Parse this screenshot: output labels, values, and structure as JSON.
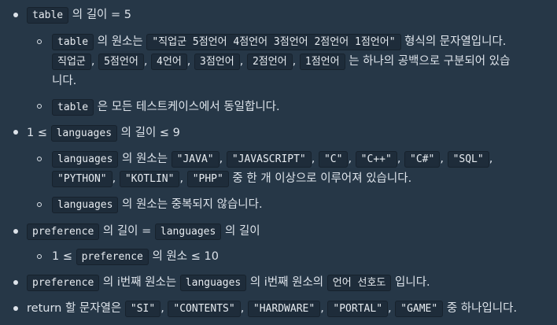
{
  "items": [
    {
      "parts": [
        {
          "c": "table"
        },
        {
          "t": " 의 길이 = 5"
        }
      ]
    },
    {
      "parts": [
        {
          "c": "table"
        },
        {
          "t": " 의 원소는 "
        },
        {
          "c": "\"직업군 5점언어 4점언어 3점언어 2점언어 1점언어\""
        },
        {
          "t": " 형식의 문자열입니다."
        }
      ]
    },
    {
      "parts": [
        {
          "c": "직업군"
        },
        {
          "t": ", "
        },
        {
          "c": "5점언어"
        },
        {
          "t": ", "
        },
        {
          "c": "4언어"
        },
        {
          "t": ", "
        },
        {
          "c": "3점언어"
        },
        {
          "t": ", "
        },
        {
          "c": "2점언어"
        },
        {
          "t": ", "
        },
        {
          "c": "1점언어"
        },
        {
          "t": " 는 하나의 공백으로 구분되어 있습"
        }
      ]
    },
    {
      "parts": [
        {
          "t": "니다."
        }
      ]
    },
    {
      "parts": [
        {
          "c": "table"
        },
        {
          "t": " 은 모든 테스트케이스에서 동일합니다."
        }
      ]
    },
    {
      "parts": [
        {
          "t": "1 ≤ "
        },
        {
          "c": "languages"
        },
        {
          "t": " 의 길이 ≤ 9"
        }
      ]
    },
    {
      "parts": [
        {
          "c": "languages"
        },
        {
          "t": " 의 원소는 "
        },
        {
          "c": "\"JAVA\""
        },
        {
          "t": ", "
        },
        {
          "c": "\"JAVASCRIPT\""
        },
        {
          "t": ", "
        },
        {
          "c": "\"C\""
        },
        {
          "t": ", "
        },
        {
          "c": "\"C++\""
        },
        {
          "t": ", "
        },
        {
          "c": "\"C#\""
        },
        {
          "t": ", "
        },
        {
          "c": "\"SQL\""
        },
        {
          "t": ","
        }
      ]
    },
    {
      "parts": [
        {
          "c": "\"PYTHON\""
        },
        {
          "t": ", "
        },
        {
          "c": "\"KOTLIN\""
        },
        {
          "t": ", "
        },
        {
          "c": "\"PHP\""
        },
        {
          "t": " 중 한 개 이상으로 이루어져 있습니다."
        }
      ]
    },
    {
      "parts": [
        {
          "c": "languages"
        },
        {
          "t": " 의 원소는 중복되지 않습니다."
        }
      ]
    },
    {
      "parts": [
        {
          "c": "preference"
        },
        {
          "t": " 의 길이 = "
        },
        {
          "c": "languages"
        },
        {
          "t": " 의 길이"
        }
      ]
    },
    {
      "parts": [
        {
          "t": "1 ≤ "
        },
        {
          "c": "preference"
        },
        {
          "t": " 의 원소 ≤ 10"
        }
      ]
    },
    {
      "parts": [
        {
          "c": "preference"
        },
        {
          "t": " 의 i번째 원소는 "
        },
        {
          "c": "languages"
        },
        {
          "t": " 의 i번째 원소의 "
        },
        {
          "c": "언어 선호도"
        },
        {
          "t": " 입니다."
        }
      ]
    },
    {
      "parts": [
        {
          "t": "return 할 문자열은 "
        },
        {
          "c": "\"SI\""
        },
        {
          "t": ", "
        },
        {
          "c": "\"CONTENTS\""
        },
        {
          "t": ", "
        },
        {
          "c": "\"HARDWARE\""
        },
        {
          "t": ", "
        },
        {
          "c": "\"PORTAL\""
        },
        {
          "t": ", "
        },
        {
          "c": "\"GAME\""
        },
        {
          "t": " 중 하나입니다."
        }
      ]
    }
  ]
}
